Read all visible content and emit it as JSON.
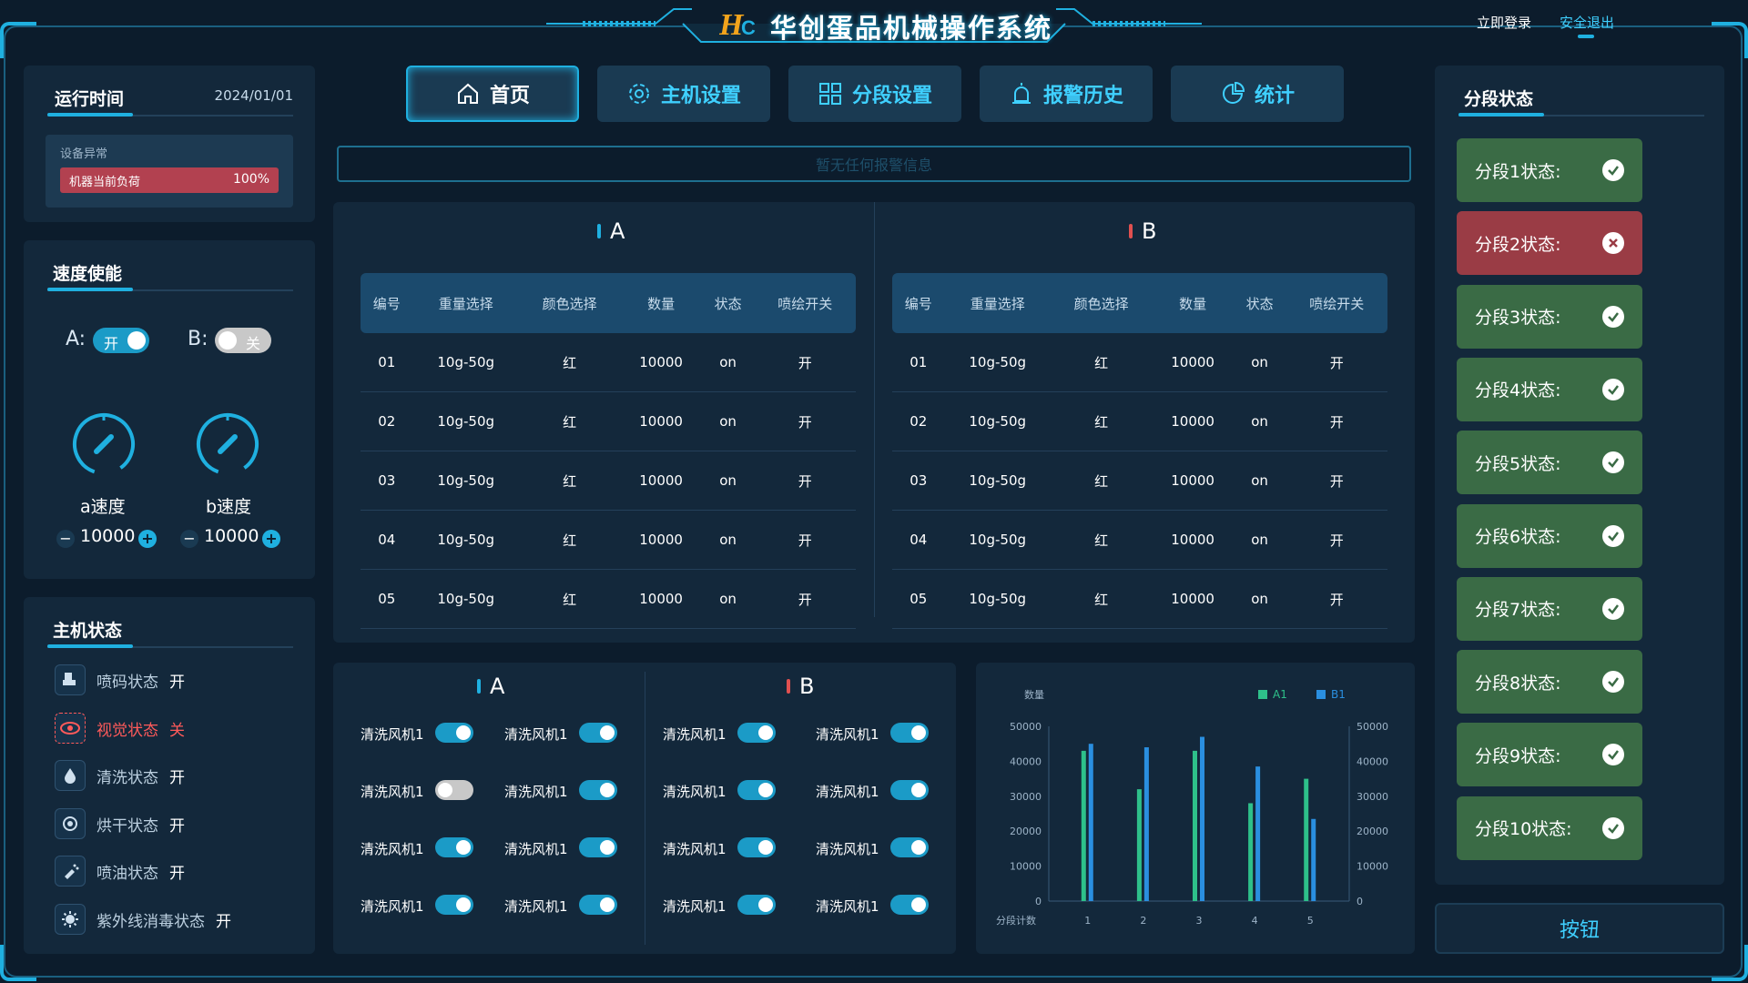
{
  "app": {
    "title": "华创蛋品机械操作系统",
    "login": "立即登录",
    "logout": "安全退出"
  },
  "nav": [
    {
      "label": "首页",
      "icon": "home-icon",
      "active": true
    },
    {
      "label": "主机设置",
      "icon": "gear-icon"
    },
    {
      "label": "分段设置",
      "icon": "grid-icon"
    },
    {
      "label": "报警历史",
      "icon": "alarm-icon"
    },
    {
      "label": "统计",
      "icon": "pie-icon"
    }
  ],
  "alarm_banner": "暂无任何报警信息",
  "runtime": {
    "title": "运行时间",
    "date": "2024/01/01",
    "fault_label": "设备异常",
    "load_label": "机器当前负荷",
    "load_percent": "100%",
    "load_fraction": 1.0
  },
  "speed": {
    "title": "速度使能",
    "a": {
      "label": "A:",
      "toggle": "开",
      "on": true,
      "gauge_label": "a速度",
      "value": "10000"
    },
    "b": {
      "label": "B:",
      "toggle": "关",
      "on": false,
      "gauge_label": "b速度",
      "value": "10000"
    }
  },
  "host_status": {
    "title": "主机状态",
    "items": [
      {
        "label": "喷码状态",
        "value": "开",
        "icon": "printer-icon",
        "alert": false
      },
      {
        "label": "视觉状态",
        "value": "关",
        "icon": "eye-icon",
        "alert": true
      },
      {
        "label": "清洗状态",
        "value": "开",
        "icon": "water-drop-icon",
        "alert": false
      },
      {
        "label": "烘干状态",
        "value": "开",
        "icon": "dryer-icon",
        "alert": false
      },
      {
        "label": "喷油状态",
        "value": "开",
        "icon": "spray-icon",
        "alert": false
      },
      {
        "label": "紫外线消毒状态",
        "value": "开",
        "icon": "uv-icon",
        "alert": false
      }
    ]
  },
  "tables": {
    "headers": [
      "编号",
      "重量选择",
      "颜色选择",
      "数量",
      "状态",
      "喷绘开关"
    ],
    "A": {
      "label": "A",
      "rows": [
        [
          "01",
          "10g-50g",
          "红",
          "10000",
          "on",
          "开"
        ],
        [
          "02",
          "10g-50g",
          "红",
          "10000",
          "on",
          "开"
        ],
        [
          "03",
          "10g-50g",
          "红",
          "10000",
          "on",
          "开"
        ],
        [
          "04",
          "10g-50g",
          "红",
          "10000",
          "on",
          "开"
        ],
        [
          "05",
          "10g-50g",
          "红",
          "10000",
          "on",
          "开"
        ]
      ]
    },
    "B": {
      "label": "B",
      "rows": [
        [
          "01",
          "10g-50g",
          "红",
          "10000",
          "on",
          "开"
        ],
        [
          "02",
          "10g-50g",
          "红",
          "10000",
          "on",
          "开"
        ],
        [
          "03",
          "10g-50g",
          "红",
          "10000",
          "on",
          "开"
        ],
        [
          "04",
          "10g-50g",
          "红",
          "10000",
          "on",
          "开"
        ],
        [
          "05",
          "10g-50g",
          "红",
          "10000",
          "on",
          "开"
        ]
      ]
    }
  },
  "fans": {
    "A": {
      "label": "A",
      "items": [
        {
          "label": "清洗风机1",
          "on": true
        },
        {
          "label": "清洗风机1",
          "on": true
        },
        {
          "label": "清洗风机1",
          "on": false
        },
        {
          "label": "清洗风机1",
          "on": true
        },
        {
          "label": "清洗风机1",
          "on": true
        },
        {
          "label": "清洗风机1",
          "on": true
        },
        {
          "label": "清洗风机1",
          "on": true
        },
        {
          "label": "清洗风机1",
          "on": true
        }
      ]
    },
    "B": {
      "label": "B",
      "items": [
        {
          "label": "清洗风机1",
          "on": true
        },
        {
          "label": "清洗风机1",
          "on": true
        },
        {
          "label": "清洗风机1",
          "on": true
        },
        {
          "label": "清洗风机1",
          "on": true
        },
        {
          "label": "清洗风机1",
          "on": true
        },
        {
          "label": "清洗风机1",
          "on": true
        },
        {
          "label": "清洗风机1",
          "on": true
        },
        {
          "label": "清洗风机1",
          "on": true
        }
      ]
    }
  },
  "chart_data": {
    "type": "bar",
    "ylabel": "数量",
    "xlabel": "分段计数",
    "categories": [
      "1",
      "2",
      "3",
      "4",
      "5"
    ],
    "series": [
      {
        "name": "A1",
        "values": [
          43000,
          32000,
          43000,
          28000,
          35000
        ],
        "color": "#2ec08a"
      },
      {
        "name": "B1",
        "values": [
          45000,
          44000,
          47000,
          38500,
          23500
        ],
        "color": "#2a8fe0"
      }
    ],
    "ylim": [
      0,
      50000
    ],
    "yticks": [
      "50000",
      "40000",
      "30000",
      "20000",
      "10000",
      "0"
    ],
    "legend": "top-right",
    "grid": false
  },
  "segments": {
    "title": "分段状态",
    "items": [
      {
        "label": "分段1状态:",
        "ok": true
      },
      {
        "label": "分段2状态:",
        "ok": false
      },
      {
        "label": "分段3状态:",
        "ok": true
      },
      {
        "label": "分段4状态:",
        "ok": true
      },
      {
        "label": "分段5状态:",
        "ok": true
      },
      {
        "label": "分段6状态:",
        "ok": true
      },
      {
        "label": "分段7状态:",
        "ok": true
      },
      {
        "label": "分段8状态:",
        "ok": true
      },
      {
        "label": "分段9状态:",
        "ok": true
      },
      {
        "label": "分段10状态:",
        "ok": true
      }
    ],
    "button": "按钮"
  },
  "colors": {
    "accent": "#1fb0e0",
    "ok": "#3a6b45",
    "error": "#9a3c45",
    "alert_text": "#ff5a5a"
  }
}
